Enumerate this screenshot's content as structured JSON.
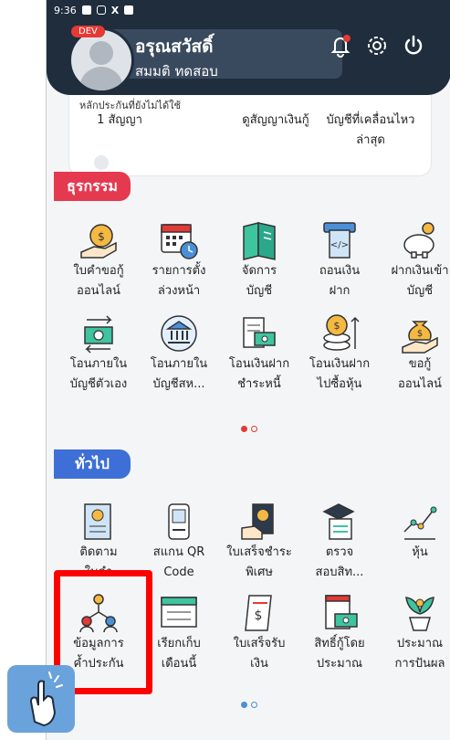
{
  "status_bar": {
    "time": "9:36",
    "letter": "X"
  },
  "header": {
    "badge": "DEV",
    "user_name": "อรุณสวัสดิ์",
    "user_sub": "สมมติ ทดสอบ"
  },
  "info_card": {
    "cut_text": "หลักประกันที่ยังไม่ได้ใช้",
    "contracts": "1 สัญญา",
    "view_loan": "ดูสัญญาเงินกู้",
    "recent_line1": "บัญชีที่เคลื่อนไหว",
    "recent_line2": "ล่าสุด"
  },
  "sections": {
    "transactions": {
      "title": "ธุรกรรม",
      "items": [
        {
          "l1": "ใบคำขอกู้",
          "l2": "ออนไลน์",
          "icon": "loan-bag-icon"
        },
        {
          "l1": "รายการตั้ง",
          "l2": "ล่วงหน้า",
          "icon": "calendar-clock-icon"
        },
        {
          "l1": "จัดการ",
          "l2": "บัญชี",
          "icon": "book-icon"
        },
        {
          "l1": "ถอนเงิน",
          "l2": "ฝาก",
          "icon": "atm-icon"
        },
        {
          "l1": "ฝากเงินเข้า",
          "l2": "บัญชี",
          "icon": "piggy-bank-icon"
        },
        {
          "l1": "โอนภายใน",
          "l2": "บัญชีตัวเอง",
          "icon": "transfer-icon"
        },
        {
          "l1": "โอนภายใน",
          "l2": "บัญชีสห...",
          "icon": "bank-icon"
        },
        {
          "l1": "โอนเงินฝาก",
          "l2": "ชำระหนี้",
          "icon": "invoice-icon"
        },
        {
          "l1": "โอนเงินฝาก",
          "l2": "ไปซื้อหุ้น",
          "icon": "coins-icon"
        },
        {
          "l1": "ขอกู้",
          "l2": "ออนไลน์",
          "icon": "hand-bag-icon"
        }
      ]
    },
    "general": {
      "title": "ทั่วไป",
      "items": [
        {
          "l1": "ติดตาม",
          "l2": "ใบคำ",
          "icon": "document-icon"
        },
        {
          "l1": "สแกน QR",
          "l2": "Code",
          "icon": "qr-scan-icon"
        },
        {
          "l1": "ใบเสร็จชำระ",
          "l2": "พิเศษ",
          "icon": "receipt-hand-icon"
        },
        {
          "l1": "ตรวจ",
          "l2": "สอบสิท...",
          "icon": "graduation-icon"
        },
        {
          "l1": "หุ้น",
          "l2": "",
          "icon": "growth-icon"
        },
        {
          "l1": "ข้อมูลการ",
          "l2": "ค้ำประกัน",
          "icon": "network-people-icon"
        },
        {
          "l1": "เรียกเก็บ",
          "l2": "เดือนนี้",
          "icon": "bill-icon"
        },
        {
          "l1": "ใบเสร็จรับ",
          "l2": "เงิน",
          "icon": "receipt-icon"
        },
        {
          "l1": "สิทธิ์กู้โดย",
          "l2": "ประมาณ",
          "icon": "money-doc-icon"
        },
        {
          "l1": "ประมาณ",
          "l2": "การปันผล",
          "icon": "plant-icon"
        }
      ]
    }
  },
  "colors": {
    "header": "#1f2d3d",
    "transactions_pill": "#e53950",
    "general_pill": "#3d6fd6",
    "highlight": "#ff0000",
    "dot_active": "#e53935"
  }
}
